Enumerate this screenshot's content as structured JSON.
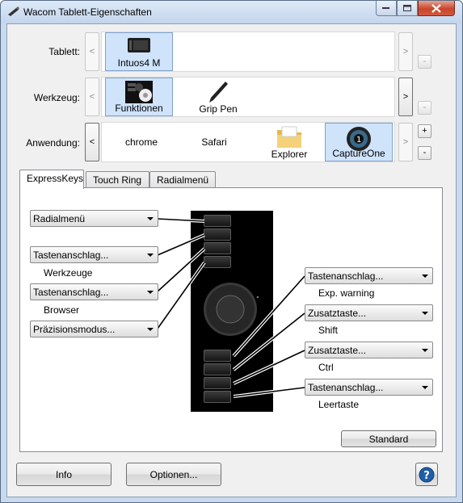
{
  "window": {
    "title": "Wacom Tablett-Eigenschaften"
  },
  "rows": {
    "tablet": {
      "label": "Tablett:",
      "items": [
        {
          "label": "Intuos4 M",
          "icon": "tablet-icon"
        }
      ]
    },
    "tool": {
      "label": "Werkzeug:",
      "items": [
        {
          "label": "Funktionen",
          "icon": "functions-icon"
        },
        {
          "label": "Grip Pen",
          "icon": "pen-icon"
        }
      ]
    },
    "app": {
      "label": "Anwendung:",
      "items": [
        {
          "label": "chrome"
        },
        {
          "label": "Safari"
        },
        {
          "label": "Explorer",
          "icon": "folder-icon"
        },
        {
          "label": "CaptureOne",
          "icon": "captureone-icon"
        }
      ]
    }
  },
  "nav": {
    "prev": "<",
    "next": ">",
    "add": "+",
    "remove": "-"
  },
  "tabs": [
    "ExpressKeys",
    "Touch Ring",
    "Radialmenü"
  ],
  "left_keys": [
    {
      "value": "Radialmenü",
      "sub": ""
    },
    {
      "value": "Tastenanschlag...",
      "sub": "Werkzeuge"
    },
    {
      "value": "Tastenanschlag...",
      "sub": "Browser"
    },
    {
      "value": "Präzisionsmodus...",
      "sub": ""
    }
  ],
  "right_keys": [
    {
      "value": "Tastenanschlag...",
      "sub": "Exp. warning"
    },
    {
      "value": "Zusatztaste...",
      "sub": "Shift"
    },
    {
      "value": "Zusatztaste...",
      "sub": "Ctrl"
    },
    {
      "value": "Tastenanschlag...",
      "sub": "Leertaste"
    }
  ],
  "buttons": {
    "standard": "Standard",
    "info": "Info",
    "options": "Optionen...",
    "help": "?"
  },
  "colors": {
    "selection": "#cfe3fb",
    "help": "#1f5fa8",
    "close": "#c6462d"
  }
}
